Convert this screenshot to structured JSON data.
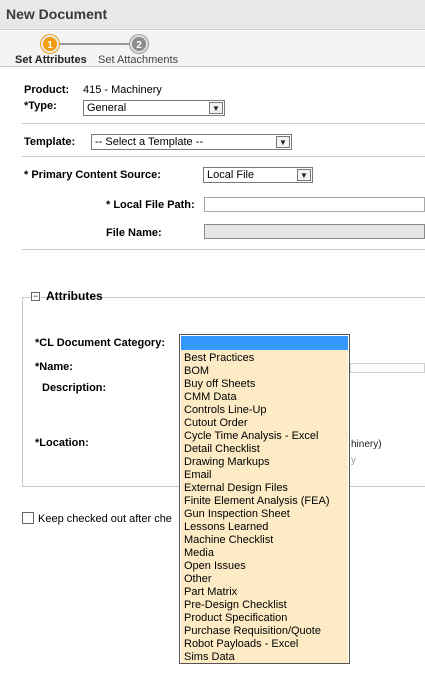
{
  "window": {
    "title": "New Document"
  },
  "wizard": {
    "steps": [
      {
        "number": "1",
        "label": "Set Attributes"
      },
      {
        "number": "2",
        "label": "Set Attachments"
      }
    ]
  },
  "form": {
    "product_label": "Product:",
    "product_value": "415 - Machinery",
    "type_label": "*Type:",
    "type_value": "General",
    "template_label": "Template:",
    "template_value": "-- Select a Template --",
    "primary_source_label": "* Primary Content Source:",
    "primary_source_value": "Local File",
    "local_file_path_label": "* Local File Path:",
    "local_file_path_value": "",
    "file_name_label": "File Name:",
    "file_name_value": ""
  },
  "attributes": {
    "legend": "Attributes",
    "collapse_symbol": "−",
    "category_label": "*CL Document Category:",
    "name_label": "*Name:",
    "description_label": "Description:",
    "location_label": "*Location:",
    "location_partial_text": "hinery)",
    "location_partial_gray": "y"
  },
  "keep_checked_out": {
    "label": "Keep checked out after che",
    "checked": false
  },
  "category_dropdown": {
    "selected": "",
    "options": [
      "Best Practices",
      "BOM",
      "Buy off Sheets",
      "CMM Data",
      "Controls Line-Up",
      "Cutout Order",
      "Cycle Time Analysis - Excel",
      "Detail Checklist",
      "Drawing Markups",
      "Email",
      "External Design Files",
      "Finite Element Analysis (FEA)",
      "Gun Inspection Sheet",
      "Lessons Learned",
      "Machine Checklist",
      "Media",
      "Open Issues",
      "Other",
      "Part Matrix",
      "Pre-Design Checklist",
      "Product Specification",
      "Purchase Requisition/Quote",
      "Robot Payloads - Excel",
      "Sims Data"
    ]
  },
  "icons": {
    "dropdown_arrow": "chevron-down-icon"
  },
  "colors": {
    "step_active": "#f39c12",
    "step_inactive": "#8c8c8c",
    "dropdown_bg": "#fdebc6",
    "highlight": "#3399ff"
  }
}
